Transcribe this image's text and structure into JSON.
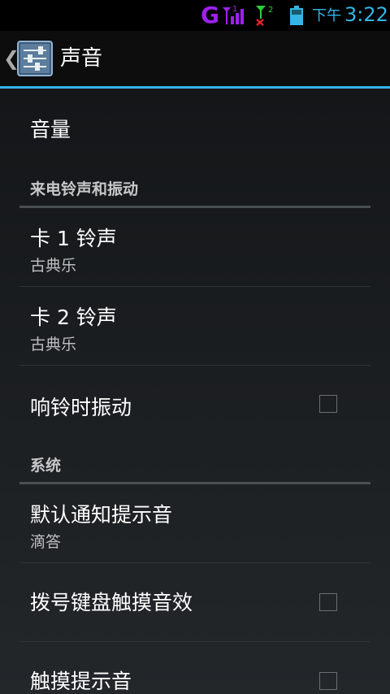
{
  "status_bar": {
    "network_type": "G",
    "sim1_indicator": "1",
    "sim2_indicator": "2",
    "time_label": "下午",
    "time": "3:22",
    "icons": [
      "signal-sim1-icon",
      "signal-sim2-no-service-icon",
      "battery-icon"
    ],
    "accent_color": "#33b5e5",
    "network_color": "#a020f0"
  },
  "action_bar": {
    "title": "声音",
    "back_icon": "chevron-left-icon",
    "app_icon": "settings-sliders-icon"
  },
  "settings": {
    "volume": {
      "title": "音量"
    },
    "category_incoming": {
      "label": "来电铃声和振动"
    },
    "sim1_ringtone": {
      "title": "卡 1 铃声",
      "summary": "古典乐"
    },
    "sim2_ringtone": {
      "title": "卡 2 铃声",
      "summary": "古典乐"
    },
    "vibrate_on_ring": {
      "title": "响铃时振动",
      "checked": false
    },
    "category_system": {
      "label": "系统"
    },
    "default_notification": {
      "title": "默认通知提示音",
      "summary": "滴答"
    },
    "dial_pad_tones": {
      "title": "拨号键盘触摸音效",
      "checked": false
    },
    "touch_sounds": {
      "title": "触摸提示音",
      "checked": false
    }
  }
}
